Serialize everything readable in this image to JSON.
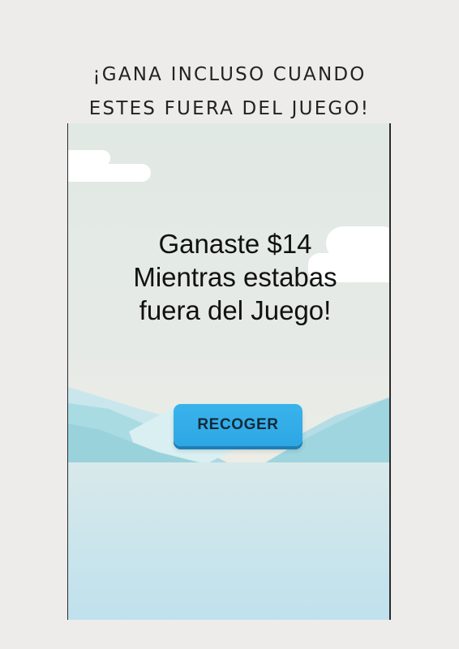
{
  "headline": {
    "line1": "¡GANA INCLUSO CUANDO",
    "line2": "ESTES FUERA DEL JUEGO!"
  },
  "game_screen": {
    "message": {
      "line1": "Ganaste $14",
      "line2": "Mientras estabas",
      "line3": "fuera del Juego!"
    },
    "collect_button": "RECOGER"
  }
}
